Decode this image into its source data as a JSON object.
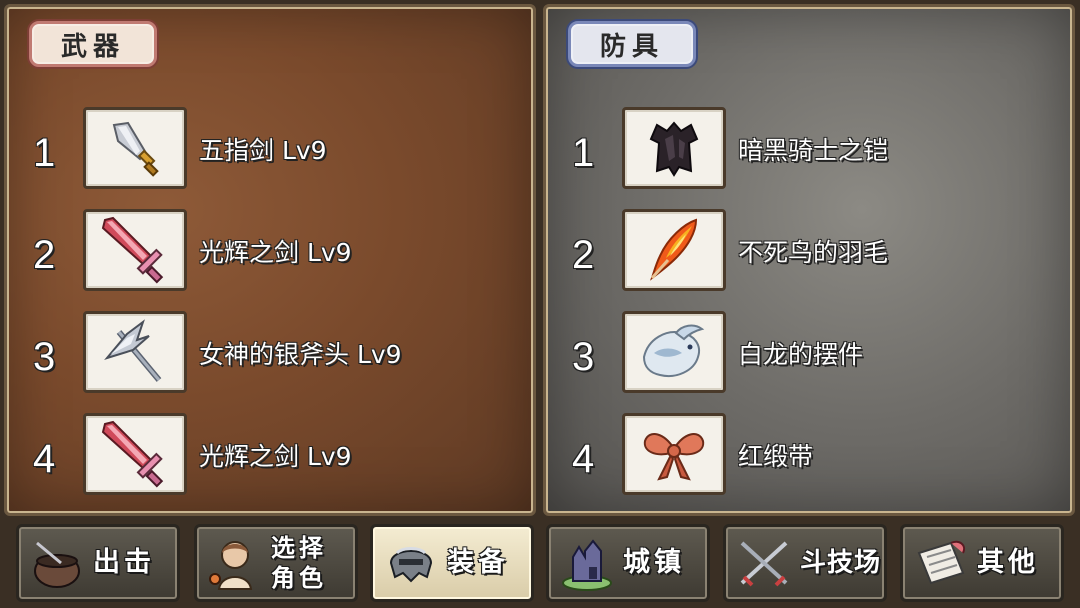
{
  "weapons": {
    "title": "武器",
    "items": [
      {
        "index": "1",
        "name": "五指剑 Lv9",
        "icon": "dagger-icon"
      },
      {
        "index": "2",
        "name": "光辉之剑 Lv9",
        "icon": "radiant-sword-icon"
      },
      {
        "index": "3",
        "name": "女神的银斧头 Lv9",
        "icon": "silver-axe-icon"
      },
      {
        "index": "4",
        "name": "光辉之剑 Lv9",
        "icon": "radiant-sword-icon"
      }
    ]
  },
  "armor": {
    "title": "防具",
    "items": [
      {
        "index": "1",
        "name": "暗黑骑士之铠",
        "icon": "dark-armor-icon"
      },
      {
        "index": "2",
        "name": "不死鸟的羽毛",
        "icon": "phoenix-feather-icon"
      },
      {
        "index": "3",
        "name": "白龙的摆件",
        "icon": "white-dragon-icon"
      },
      {
        "index": "4",
        "name": "红缎带",
        "icon": "red-ribbon-icon"
      }
    ]
  },
  "nav": {
    "sortie": "出击",
    "select_line1": "选择",
    "select_line2": "角色",
    "equipment": "装备",
    "town": "城镇",
    "arena": "斗技场",
    "other": "其他",
    "active": "equipment"
  },
  "colors": {
    "weapons_panel": "#7a4a2c",
    "armor_panel": "#6e6c68",
    "weapons_tag_border": "#c07a72",
    "armor_tag_border": "#7a88b8"
  }
}
